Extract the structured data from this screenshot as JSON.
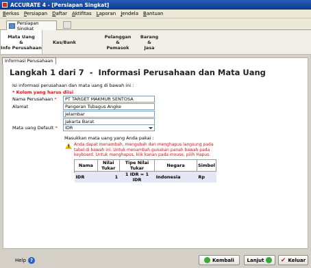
{
  "window": {
    "title": "ACCURATE 4 - [Persiapan Singkat]"
  },
  "menu": [
    "Berkas",
    "Persiapan",
    "Daftar",
    "Aktifitas",
    "Laporan",
    "Jendela",
    "Bantuan"
  ],
  "doc_tab": {
    "label": "Persiapan Singkat"
  },
  "wizard_steps": [
    {
      "label": "Mata Uang\n&\nInfo Perusahaan",
      "active": true
    },
    {
      "label": "Kas/Bank",
      "active": false
    },
    {
      "label": "Pelanggan\n&\nPemasok",
      "active": false
    },
    {
      "label": "Barang\n&\nJasa",
      "active": false
    }
  ],
  "section_tab": "Informasi Perusahaan",
  "heading": {
    "step": "Langkah 1 dari 7",
    "sep": "-",
    "title": "Informasi Perusahaan dan Mata Uang"
  },
  "intro": "Isi informasi perusahaan dan mata uang di bawah ini :",
  "required_note": "* Kolom yang harus diisi",
  "form": {
    "company_label": "Nama Perusahaan",
    "company_value": "PT TARGET MAKMUR SENTOSA",
    "address_label": "Alamat",
    "address_lines": [
      "Pangeran Tubagus Angke",
      "Jelambar",
      "Jakarta Barat"
    ],
    "currency_label": "Mata uang Default",
    "currency_value": "IDR",
    "star": "*"
  },
  "currency_prompt": "Masukkan mata uang yang Anda pakai :",
  "warning": "Anda dapat menambah, mengubah dan menghapus langsung pada tabel di bawah ini. Untuk menambah gunakan panah bawah pada keyboard. Untuk menghapus, klik kanan pada mouse, pilih Hapus.",
  "currency_table": {
    "headers": [
      "Nama",
      "Nilai Tukar",
      "Tipe Nilai Tukar",
      "Negara",
      "Simbol"
    ],
    "rows": [
      [
        "IDR",
        "1",
        "1 IDR = 1 IDR",
        "Indonesia",
        "Rp"
      ]
    ]
  },
  "footer": {
    "help": "Help",
    "back": "Kembali",
    "next": "Lanjut",
    "exit": "Keluar"
  }
}
